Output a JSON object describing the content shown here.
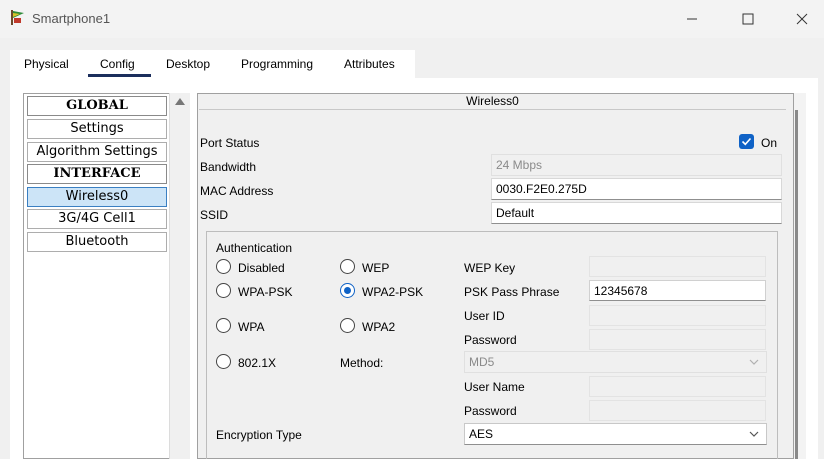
{
  "window": {
    "title": "Smartphone1"
  },
  "tabs": [
    "Physical",
    "Config",
    "Desktop",
    "Programming",
    "Attributes"
  ],
  "nav": {
    "items": [
      "GLOBAL",
      "Settings",
      "Algorithm Settings",
      "INTERFACE",
      "Wireless0",
      "3G/4G Cell1",
      "Bluetooth"
    ],
    "selected": "Wireless0"
  },
  "panel": {
    "title": "Wireless0",
    "port_status_label": "Port Status",
    "port_status_checked": true,
    "port_status_check_label": "On",
    "bandwidth_label": "Bandwidth",
    "bandwidth_value": "24 Mbps",
    "mac_label": "MAC Address",
    "mac_value": "0030.F2E0.275D",
    "ssid_label": "SSID",
    "ssid_value": "Default"
  },
  "auth": {
    "title": "Authentication",
    "options": [
      "Disabled",
      "WEP",
      "WPA-PSK",
      "WPA2-PSK",
      "WPA",
      "WPA2",
      "802.1X"
    ],
    "selected": "WPA2-PSK",
    "wep_key_label": "WEP Key",
    "wep_key_value": "",
    "psk_label": "PSK Pass Phrase",
    "psk_value": "12345678",
    "user_id_label": "User ID",
    "user_id_value": "",
    "password_label": "Password",
    "password_value": "",
    "method_label": "Method:",
    "method_value": "MD5",
    "user_name_label": "User Name",
    "user_name_value": "",
    "password2_label": "Password",
    "password2_value": "",
    "encryption_label": "Encryption Type",
    "encryption_value": "AES"
  },
  "colors": {
    "accent": "#0f62c6",
    "selection": "#cce4f7",
    "tab_underline": "#1b2e5c"
  }
}
